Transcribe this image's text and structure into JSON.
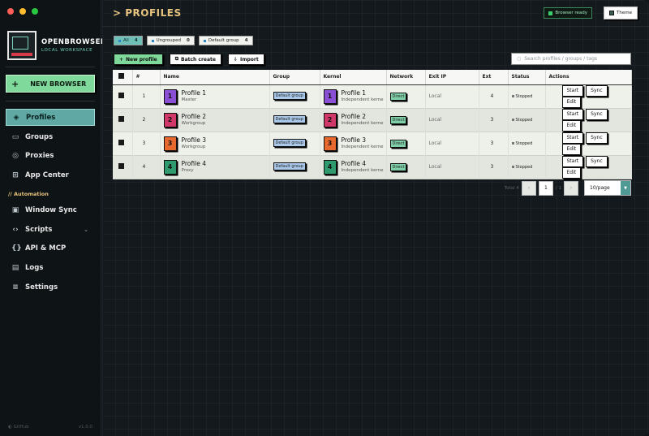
{
  "colors": {
    "accent": "#5fa8a3",
    "brand_green": "#7fd99a",
    "heading": "#e8c37f",
    "close": "#ff5f57",
    "minimize": "#febc2e",
    "maximize": "#28c840"
  },
  "brand": {
    "name": "OPENBROWSER",
    "subtitle": "LOCAL WORKSPACE"
  },
  "sidebar": {
    "new_button": "NEW BROWSER",
    "items": [
      {
        "label": "Profiles",
        "icon": "layers-icon"
      },
      {
        "label": "Groups",
        "icon": "folder-icon"
      },
      {
        "label": "Proxies",
        "icon": "globe-icon"
      },
      {
        "label": "App Center",
        "icon": "grid-plus-icon"
      }
    ],
    "section": "// Automation",
    "auto_items": [
      {
        "label": "Window Sync",
        "icon": "monitor-icon"
      },
      {
        "label": "Scripts",
        "icon": "code-icon"
      },
      {
        "label": "API & MCP",
        "icon": "braces-icon"
      },
      {
        "label": "Logs",
        "icon": "document-icon"
      },
      {
        "label": "Settings",
        "icon": "sliders-icon"
      }
    ],
    "footer_left": "GitHub",
    "footer_right": "v1.0.0"
  },
  "header": {
    "title": "> PROFILES",
    "status": "Browser ready",
    "theme": "Theme"
  },
  "filters": [
    {
      "label": "All",
      "count": "4"
    },
    {
      "label": "Ungrouped",
      "count": "0"
    },
    {
      "label": "Default group",
      "count": "4"
    }
  ],
  "toolbar": {
    "new": "New profile",
    "batch": "Batch create",
    "import": "Import",
    "search_placeholder": "Search profiles / groups / tags"
  },
  "table": {
    "columns": [
      "#",
      "Name",
      "Group",
      "Kernel",
      "Network",
      "Exit IP",
      "Ext",
      "Status",
      "Actions"
    ],
    "rows": [
      {
        "num": "1",
        "name": "Profile 1",
        "sub": "Master",
        "color": "#8b4fd6",
        "group": "Default group",
        "kernel": "Profile 1",
        "kernel_sub": "Independent kernel",
        "network": "Direct",
        "ip": "Local",
        "ext": "4",
        "status": "Stopped"
      },
      {
        "num": "2",
        "name": "Profile 2",
        "sub": "Workgroup",
        "color": "#d1386a",
        "group": "Default group",
        "kernel": "Profile 2",
        "kernel_sub": "Independent kernel",
        "network": "Direct",
        "ip": "Local",
        "ext": "3",
        "status": "Stopped"
      },
      {
        "num": "3",
        "name": "Profile 3",
        "sub": "Workgroup",
        "color": "#e8692e",
        "group": "Default group",
        "kernel": "Profile 3",
        "kernel_sub": "Independent kernel",
        "network": "Direct",
        "ip": "Local",
        "ext": "3",
        "status": "Stopped"
      },
      {
        "num": "4",
        "name": "Profile 4",
        "sub": "Proxy",
        "color": "#2e9a6e",
        "group": "Default group",
        "kernel": "Profile 4",
        "kernel_sub": "Independent kernel",
        "network": "Direct",
        "ip": "Local",
        "ext": "3",
        "status": "Stopped"
      }
    ],
    "row_actions": {
      "start": "Start",
      "sync": "Sync",
      "edit": "Edit"
    }
  },
  "pagination": {
    "total": "Total 4",
    "page": "1",
    "of": "/ 1",
    "prev": "‹",
    "next": "›",
    "page_size": "10/page"
  }
}
